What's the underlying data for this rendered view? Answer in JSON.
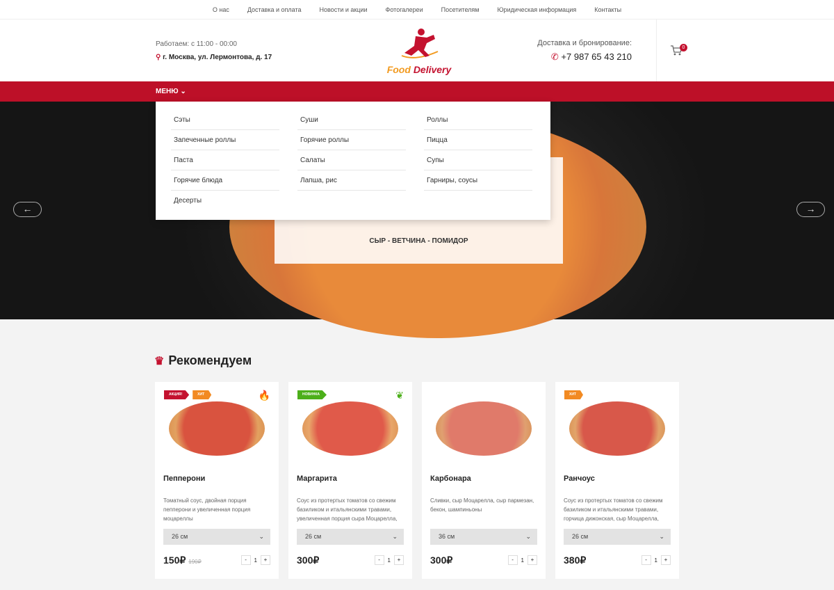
{
  "topnav": [
    "О нас",
    "Доставка и оплата",
    "Новости и акции",
    "Фотогалереи",
    "Посетителям",
    "Юридическая информация",
    "Контакты"
  ],
  "header": {
    "hours": "Работаем: с 11:00 - 00:00",
    "address": "г. Москва, ул. Лермонтова, д. 17",
    "logo_a": "Food",
    "logo_b": "Delivery",
    "delivery_label": "Доставка и бронирование:",
    "phone": "+7 987 65 43 210",
    "cart_count": "0"
  },
  "menu": {
    "label": "МЕНЮ",
    "items": [
      "Сэты",
      "Суши",
      "Роллы",
      "Запеченные роллы",
      "Горячие роллы",
      "Пицца",
      "Паста",
      "Салаты",
      "Супы",
      "Горячие блюда",
      "Лапша, рис",
      "Гарниры, соусы",
      "Десерты"
    ]
  },
  "hero": {
    "subtitle": "СЫР - ВЕТЧИНА - ПОМИДОР"
  },
  "section_title": "Рекомендуем",
  "colors": {
    "brand": "#bd1028",
    "accent": "#f29a1f",
    "new": "#4caf1a"
  },
  "products": [
    {
      "name": "Пепперони",
      "desc": "Томатный соус, двойная порция пепперони и увеличенная порция моцареллы",
      "size": "26 см",
      "price": "150₽",
      "old_price": "190₽",
      "qty": "1",
      "tags": [
        "АКЦИЯ!",
        "ХИТ"
      ],
      "icon": "fire-icon"
    },
    {
      "name": "Маргарита",
      "desc": "Соус из протертых томатов со свежим базиликом и итальянскими травами, увеличенная порция сыра Моцарелла,",
      "size": "26 см",
      "price": "300₽",
      "qty": "1",
      "tags": [
        "НОВИНКА"
      ],
      "icon": "leaf-icon"
    },
    {
      "name": "Карбонара",
      "desc": "Сливки, сыр Моцарелла, сыр пармезан, бекон, шампиньоны",
      "size": "36 см",
      "price": "300₽",
      "qty": "1",
      "tags": []
    },
    {
      "name": "Ранчоус",
      "desc": "Соус из протертых томатов со свежим базиликом и итальянскими травами, горчица дижонская, сыр Моцарелла,",
      "size": "26 см",
      "price": "380₽",
      "qty": "1",
      "tags": [
        "ХИТ"
      ]
    }
  ]
}
